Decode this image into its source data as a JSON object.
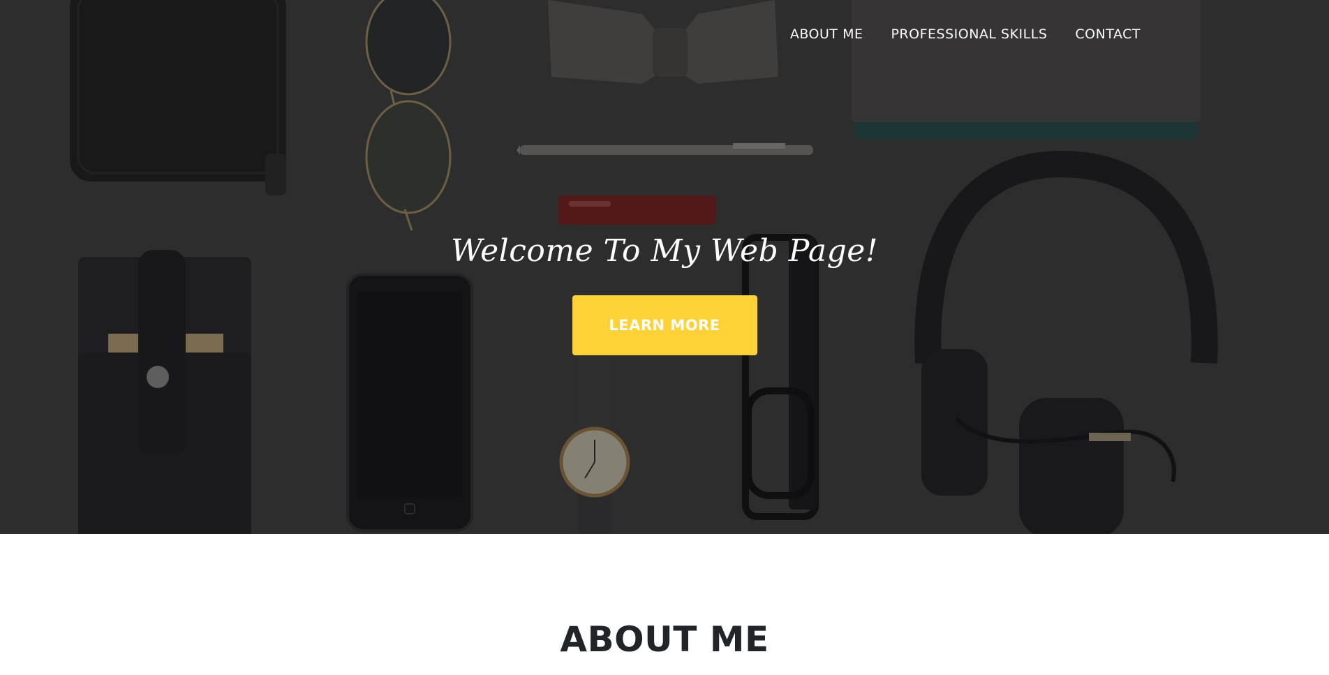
{
  "nav": {
    "items": [
      {
        "label": "ABOUT ME"
      },
      {
        "label": "PROFESSIONAL SKILLS"
      },
      {
        "label": "CONTACT"
      }
    ]
  },
  "hero": {
    "title": "Welcome To My Web Page!",
    "button_label": "LEARN MORE",
    "image": "flat-lay of wallet, sunglasses, bow tie, pen, notebook, lighter, card holder, smartphone, wristwatch, eyeglasses and headphones on dark surface"
  },
  "about": {
    "heading": "ABOUT ME"
  },
  "colors": {
    "accent": "#fed136",
    "heading_text": "#212529",
    "hero_text": "#ffffff"
  }
}
